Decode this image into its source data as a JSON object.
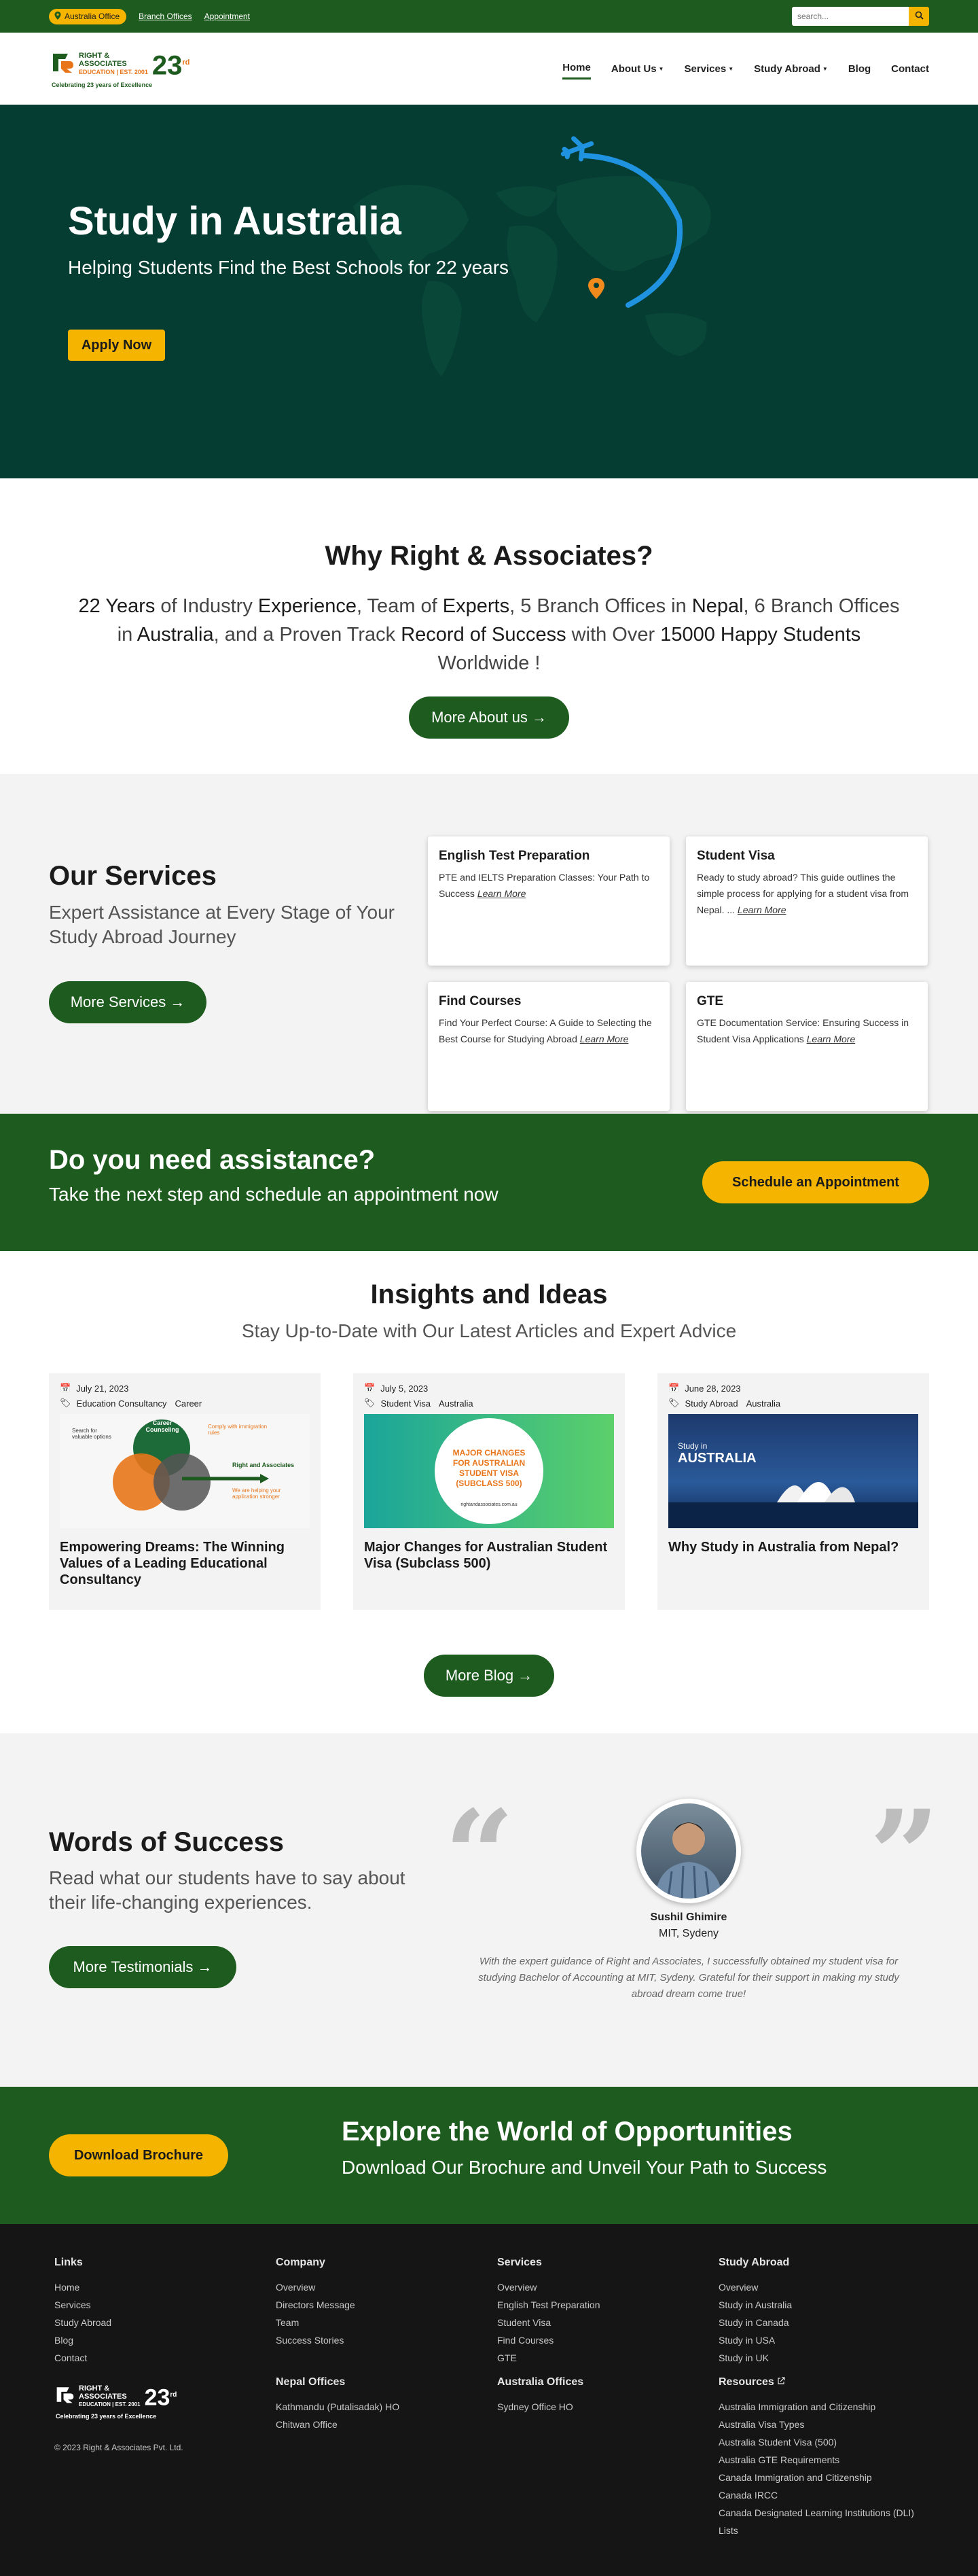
{
  "topbar": {
    "office_pill": "Australia Office",
    "branch_link": "Branch Offices",
    "appointment_link": "Appointment",
    "search_placeholder": "search..."
  },
  "logo": {
    "line1": "RIGHT &",
    "line2": "ASSOCIATES",
    "line3": "EDUCATION | EST. 2001",
    "years": "23",
    "years_suffix": "rd",
    "tagline": "Celebrating 23 years of Excellence"
  },
  "nav": {
    "items": [
      {
        "label": "Home",
        "dropdown": false
      },
      {
        "label": "About Us",
        "dropdown": true
      },
      {
        "label": "Services",
        "dropdown": true
      },
      {
        "label": "Study Abroad",
        "dropdown": true
      },
      {
        "label": "Blog",
        "dropdown": false
      },
      {
        "label": "Contact",
        "dropdown": false
      }
    ]
  },
  "hero": {
    "title": "Study in Australia",
    "subtitle": "Helping Students Find the Best Schools for 22 years",
    "apply_label": "Apply Now"
  },
  "why": {
    "title": "Why Right & Associates?",
    "parts": [
      "22 Years",
      " of Industry ",
      "Experience",
      ", Team of ",
      "Experts",
      ", 5 Branch Offices in ",
      "Nepal",
      ", 6 Branch Offices in ",
      "Australia",
      ", and a Proven Track ",
      "Record of Success",
      " with Over ",
      "15000 Happy Students",
      " Worldwide !"
    ],
    "more_label": "More About us"
  },
  "services": {
    "title": "Our Services",
    "lead": "Expert Assistance at Every Stage of Your Study Abroad Journey",
    "more_label": "More Services",
    "learn_more": "Learn More",
    "cards": [
      {
        "title": "English Test Preparation",
        "text": "PTE and IELTS Preparation Classes: Your Path to Success"
      },
      {
        "title": "Student Visa",
        "text": "Ready to study abroad? This guide outlines the simple process for applying for a student visa from Nepal. ..."
      },
      {
        "title": "Find Courses",
        "text": "Find Your Perfect Course: A Guide to Selecting the Best Course for Studying Abroad"
      },
      {
        "title": "GTE",
        "text": "GTE Documentation Service: Ensuring Success in Student Visa Applications"
      }
    ]
  },
  "assist": {
    "title": "Do you need assistance?",
    "lead": "Take the next step and schedule an appointment now",
    "button_label": "Schedule an Appointment"
  },
  "insights": {
    "title": "Insights and Ideas",
    "lead": "Stay Up-to-Date with Our Latest Articles and Expert Advice",
    "more_label": "More Blog",
    "posts": [
      {
        "date": "July 21, 2023",
        "tags": [
          "Education Consultancy",
          "Career"
        ],
        "title": "Empowering Dreams: The Winning Values of a Leading Educational Consultancy",
        "thumb": {
          "center": "Career Counseling",
          "left": "Search for valuable options",
          "right": "Comply with immigration rules",
          "pathway": "Right and Associates",
          "pathway_sub": "We are helping your application stronger"
        }
      },
      {
        "date": "July 5, 2023",
        "tags": [
          "Student Visa",
          "Australia"
        ],
        "title": "Major Changes for Australian Student Visa (Subclass 500)",
        "thumb": {
          "text": "MAJOR CHANGES FOR AUSTRALIAN STUDENT VISA (SUBCLASS 500)",
          "site": "rightandassociates.com.au"
        }
      },
      {
        "date": "June 28, 2023",
        "tags": [
          "Study Abroad",
          "Australia"
        ],
        "title": "Why Study in Australia from Nepal?",
        "thumb": {
          "small": "Study in",
          "big": "AUSTRALIA"
        }
      }
    ]
  },
  "testimonials": {
    "title": "Words of Success",
    "lead": "Read what our students have to say about their life-changing experiences.",
    "more_label": "More Testimonials",
    "name": "Sushil Ghimire",
    "school": "MIT, Sydeny",
    "text": "With the expert guidance of Right and Associates, I successfully obtained my student visa for studying Bachelor of Accounting at MIT, Sydeny. Grateful for their support in making my study abroad dream come true!"
  },
  "brochure": {
    "button_label": "Download Brochure",
    "title": "Explore the World of Opportunities",
    "lead": "Download Our Brochure and Unveil Your Path to Success"
  },
  "footer": {
    "links": {
      "title": "Links",
      "items": [
        "Home",
        "Services",
        "Study Abroad",
        "Blog",
        "Contact"
      ]
    },
    "company": {
      "title": "Company",
      "items": [
        "Overview",
        "Directors Message",
        "Team",
        "Success Stories"
      ]
    },
    "services": {
      "title": "Services",
      "items": [
        "Overview",
        "English Test Preparation",
        "Student Visa",
        "Find Courses",
        "GTE"
      ]
    },
    "study_abroad": {
      "title": "Study Abroad",
      "items": [
        "Overview",
        "Study in Australia",
        "Study in Canada",
        "Study in USA",
        "Study in UK"
      ]
    },
    "nepal_offices": {
      "title": "Nepal Offices",
      "items": [
        "Kathmandu (Putalisadak) HO",
        "Chitwan Office"
      ]
    },
    "australia_offices": {
      "title": "Australia Offices",
      "items": [
        "Sydney Office HO"
      ]
    },
    "resources": {
      "title": "Resources",
      "items": [
        "Australia Immigration and Citizenship",
        "Australia Visa Types",
        "Australia Student Visa (500)",
        "Australia GTE Requirements",
        "Canada Immigration and Citizenship",
        "Canada IRCC",
        "Canada Designated Learning Institutions (DLI) Lists"
      ]
    },
    "copyright": "© 2023 Right & Associates Pvt. Ltd."
  },
  "colors": {
    "green": "#1e5b1e",
    "hero": "#063d32",
    "yellow": "#f5b400",
    "footer": "#151515"
  }
}
